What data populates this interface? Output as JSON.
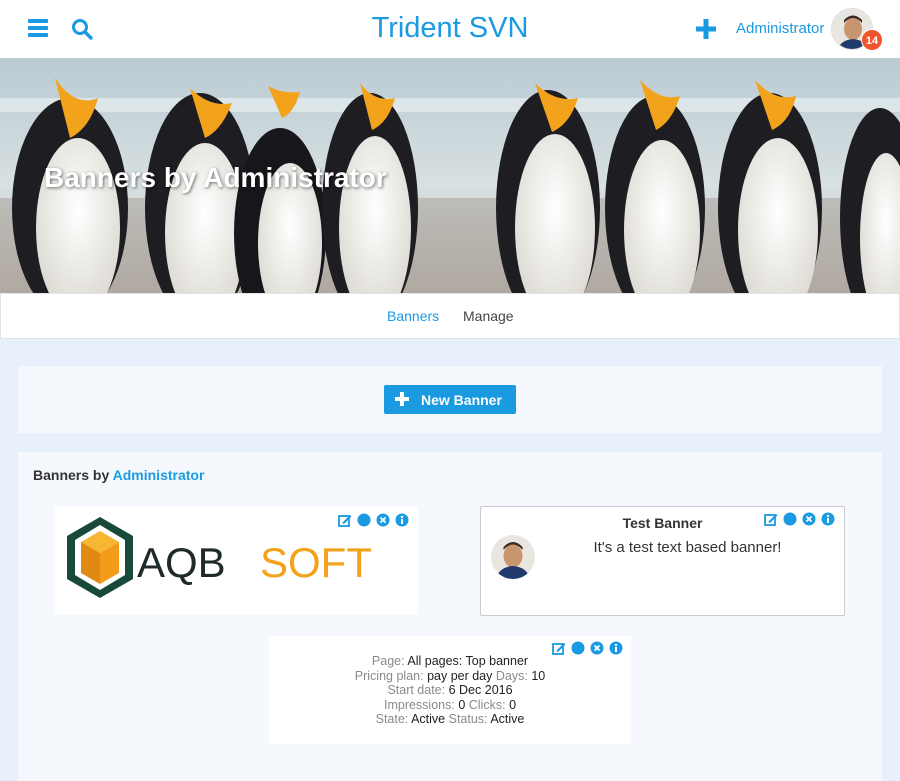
{
  "header": {
    "site_title": "Trident SVN",
    "user_name": "Administrator",
    "notification_count": "14",
    "icons": [
      "menu-icon",
      "search-icon",
      "plus-icon",
      "avatar"
    ]
  },
  "cover": {
    "title": "Banners by Administrator"
  },
  "subnav": {
    "tabs": [
      {
        "label": "Banners",
        "active": true
      },
      {
        "label": "Manage",
        "active": false
      }
    ]
  },
  "actions": {
    "new_banner_label": "New Banner"
  },
  "list": {
    "heading_prefix": "Banners by ",
    "heading_user": "Administrator",
    "logo_banner": {
      "logo_word1": "AQB",
      "logo_word2": "SOFT"
    },
    "text_banner": {
      "title": "Test Banner",
      "text": "It's a test text based banner!"
    },
    "details": {
      "page_label": "Page:",
      "page_value": "All pages: Top banner",
      "plan_label": "Pricing plan:",
      "plan_value": "pay per day",
      "days_label": "Days:",
      "days_value": "10",
      "start_label": "Start date:",
      "start_value": "6 Dec 2016",
      "impressions_label": "Impressions:",
      "impressions_value": "0",
      "clicks_label": "Clicks:",
      "clicks_value": "0",
      "state_label": "State:",
      "state_value": "Active",
      "status_label": "Status:",
      "status_value": "Active"
    }
  },
  "colors": {
    "accent": "#1a9ae0",
    "badge": "#f0552d",
    "background": "#e8f1fb"
  }
}
